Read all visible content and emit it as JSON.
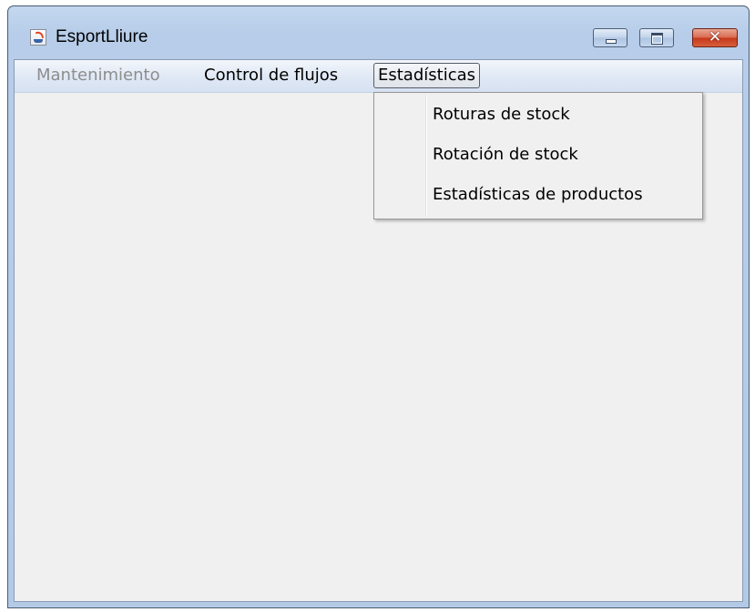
{
  "window": {
    "title": "EsportLliure",
    "app_icon": "java-cup-icon",
    "controls": {
      "minimize_icon": "minimize-icon",
      "maximize_icon": "maximize-icon",
      "close_glyph": "✕"
    }
  },
  "menubar": {
    "items": [
      {
        "label": "Mantenimiento",
        "enabled": false
      },
      {
        "label": "Control de flujos",
        "enabled": true
      },
      {
        "label": "Estadísticas",
        "enabled": true,
        "open": true
      }
    ]
  },
  "dropdown": {
    "items": [
      {
        "label": "Roturas de stock"
      },
      {
        "label": "Rotación de stock"
      },
      {
        "label": "Estadísticas de productos"
      }
    ]
  },
  "colors": {
    "titlebar": "#b9cfea",
    "close_button": "#c7371a",
    "client_background": "#f0f0f0",
    "disabled_text": "#8d8d8d"
  }
}
